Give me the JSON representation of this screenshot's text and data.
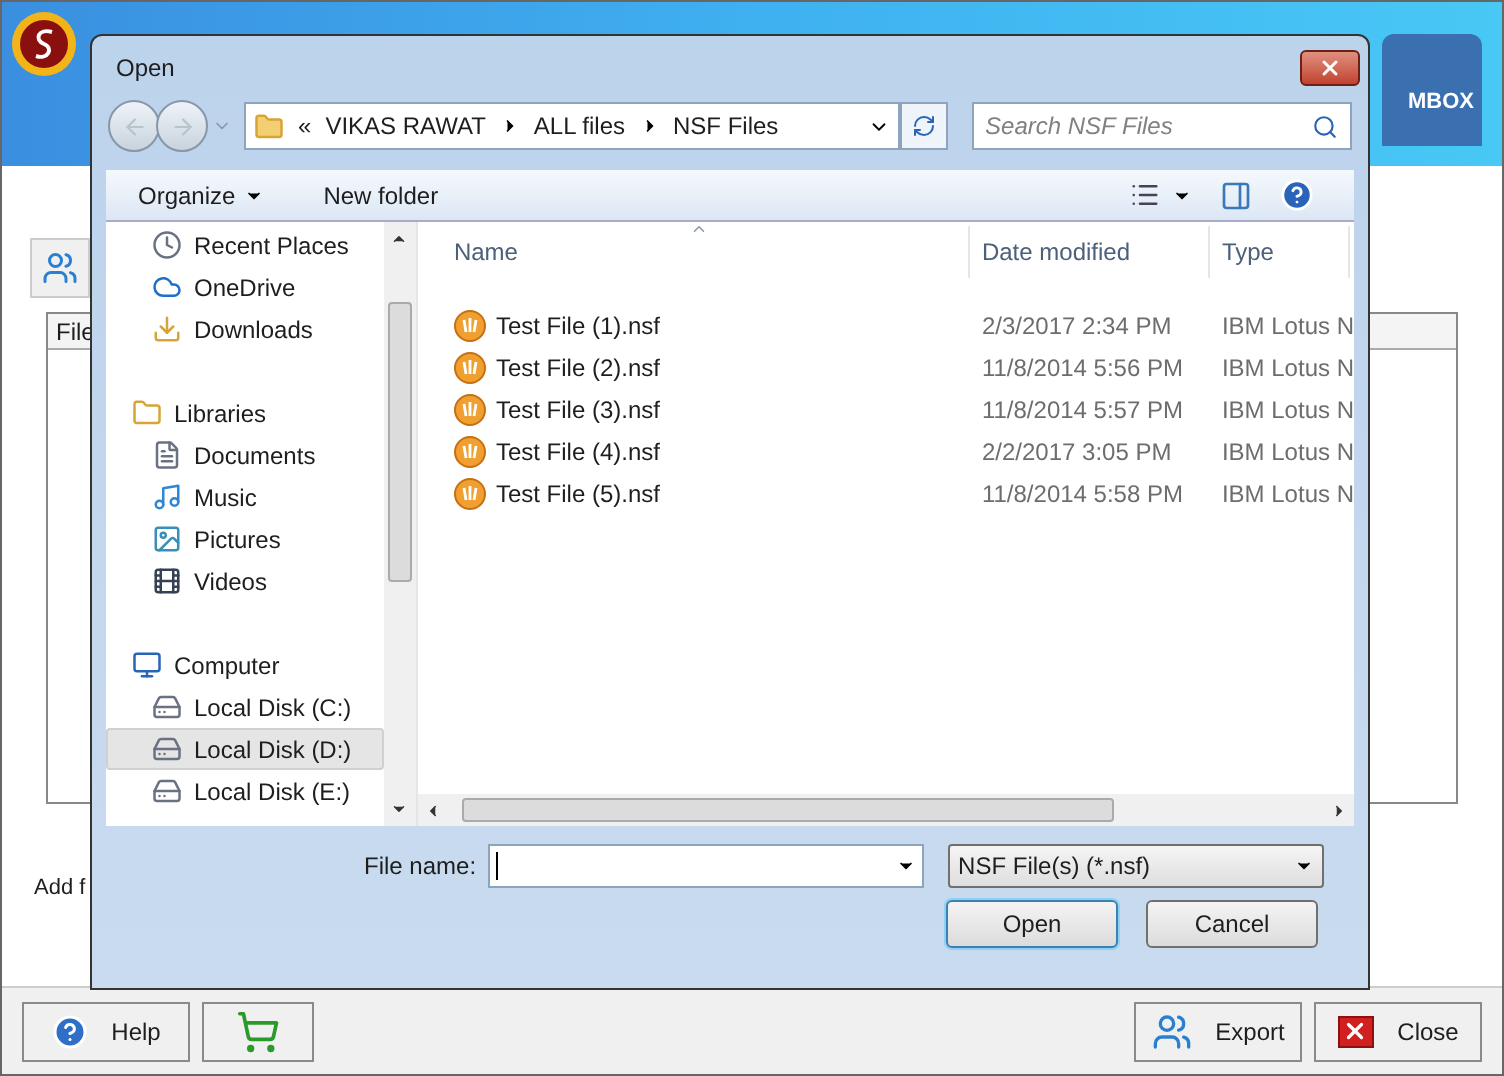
{
  "app": {
    "banner_label": "MBOX",
    "table_header": "File",
    "hint": "Add f",
    "left_buttons": [
      {
        "kind": "help",
        "label": "Help"
      },
      {
        "kind": "cart"
      }
    ],
    "right_buttons": [
      {
        "kind": "export",
        "label": "Export"
      },
      {
        "kind": "close",
        "label": "Close"
      }
    ]
  },
  "dialog": {
    "title": "Open",
    "overflow": "«",
    "path": [
      "VIKAS RAWAT",
      "ALL files",
      "NSF Files"
    ],
    "search": {
      "placeholder": "Search NSF Files"
    },
    "toolbar": {
      "organize": "Organize",
      "new_folder": "New folder"
    },
    "nav_groups": [
      {
        "items": [
          {
            "kind": "recent",
            "label": "Recent Places",
            "selected": false
          },
          {
            "kind": "cloud",
            "label": "OneDrive",
            "selected": false
          },
          {
            "kind": "downloads",
            "label": "Downloads",
            "selected": false
          }
        ]
      },
      {
        "heading": {
          "kind": "libraries",
          "label": "Libraries",
          "selected": false
        },
        "items": [
          {
            "kind": "documents",
            "label": "Documents",
            "selected": false
          },
          {
            "kind": "music",
            "label": "Music",
            "selected": false
          },
          {
            "kind": "pictures",
            "label": "Pictures",
            "selected": false
          },
          {
            "kind": "videos",
            "label": "Videos",
            "selected": false
          }
        ]
      },
      {
        "heading": {
          "kind": "computer",
          "label": "Computer",
          "selected": false
        },
        "items": [
          {
            "kind": "disk",
            "label": "Local Disk (C:)",
            "selected": false
          },
          {
            "kind": "disk",
            "label": "Local Disk (D:)",
            "selected": true
          },
          {
            "kind": "disk",
            "label": "Local Disk (E:)",
            "selected": false
          }
        ]
      }
    ],
    "columns": [
      {
        "label": "Name",
        "sorted": true
      },
      {
        "label": "Date modified",
        "sorted": false
      },
      {
        "label": "Type",
        "sorted": false
      }
    ],
    "files": [
      {
        "name": "Test File (1).nsf",
        "date": "2/3/2017 2:34 PM",
        "type": "IBM Lotus N",
        "selected": false
      },
      {
        "name": "Test File (2).nsf",
        "date": "11/8/2014 5:56 PM",
        "type": "IBM Lotus N",
        "selected": false
      },
      {
        "name": "Test File (3).nsf",
        "date": "11/8/2014 5:57 PM",
        "type": "IBM Lotus N",
        "selected": false
      },
      {
        "name": "Test File (4).nsf",
        "date": "2/2/2017 3:05 PM",
        "type": "IBM Lotus N",
        "selected": false
      },
      {
        "name": "Test File (5).nsf",
        "date": "11/8/2014 5:58 PM",
        "type": "IBM Lotus N",
        "selected": false
      }
    ],
    "file_name_label": "File name:",
    "filter": "NSF File(s) (*.nsf)",
    "buttons": [
      {
        "label": "Open",
        "default": true
      },
      {
        "label": "Cancel",
        "default": false
      }
    ]
  }
}
